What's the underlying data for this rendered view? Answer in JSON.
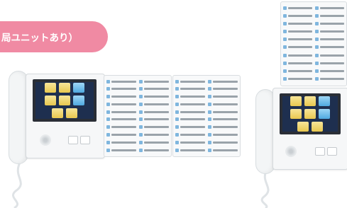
{
  "banner": {
    "text": "局ユニットあり）"
  },
  "colors": {
    "banner_bg": "#f08aa3",
    "screen_bg": "#1e2f4f"
  }
}
